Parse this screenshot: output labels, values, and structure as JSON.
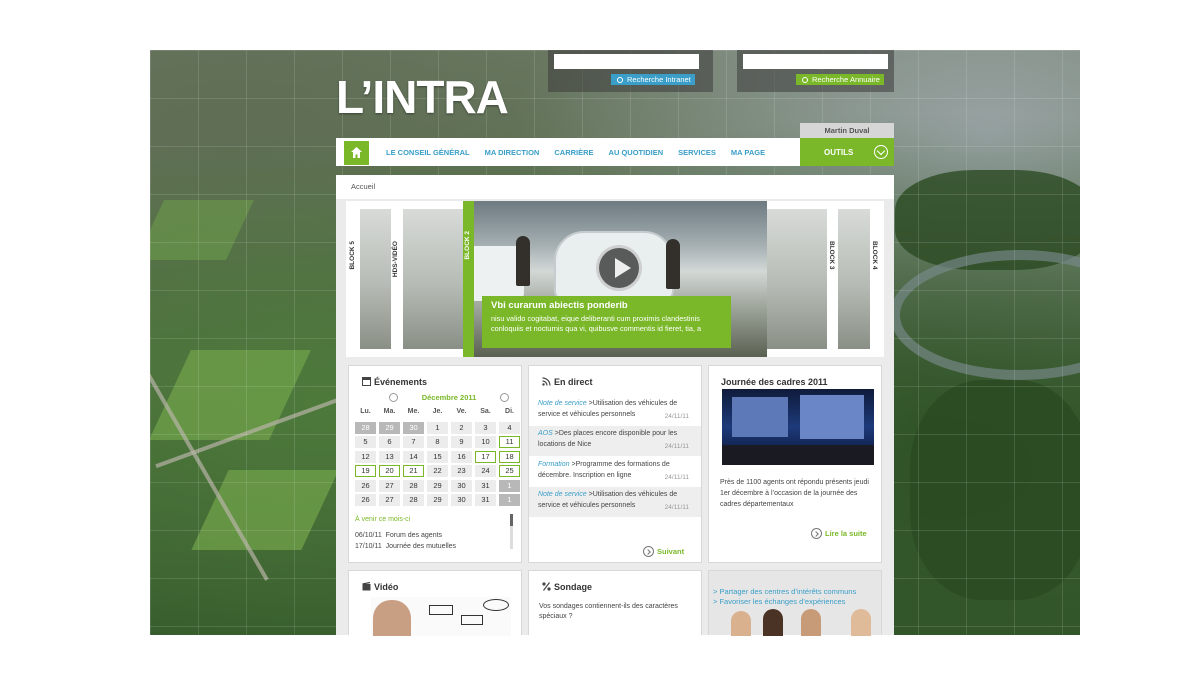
{
  "site": {
    "logo": "L’INTRA",
    "user_name": "Martin Duval"
  },
  "search": {
    "intranet_label": "Recherche Intranet",
    "directory_label": "Recherche Annuaire"
  },
  "nav": {
    "items": [
      "LE CONSEIL GÉNÉRAL",
      "MA DIRECTION",
      "CARRIÈRE",
      "AU QUOTIDIEN",
      "SERVICES",
      "MA PAGE"
    ],
    "tools_label": "OUTILS"
  },
  "breadcrumb": "Accueil",
  "carousel": {
    "tabs": [
      "BLOCK 5",
      "HDS-VIDÉO",
      "BLOCK 2",
      "BLOCK 3",
      "BLOCK 4"
    ],
    "caption_title": "Vbi curarum abiectis ponderib",
    "caption_text": "nisu valido cogitabat, eique deliberanti cum proximis clandestinis conloquiis et nocturnis qua vi, quibusve commentis id fieret, tia, a"
  },
  "events": {
    "title": "Événements",
    "month": "Décembre 2011",
    "weekdays": [
      "Lu.",
      "Ma.",
      "Me.",
      "Je.",
      "Ve.",
      "Sa.",
      "Di."
    ],
    "rows": [
      [
        "28",
        "29",
        "30",
        "1",
        "2",
        "3",
        "4"
      ],
      [
        "6",
        "7",
        "8",
        "9",
        "10",
        "11"
      ],
      [
        "13",
        "14",
        "15",
        "16",
        "17",
        "18"
      ],
      [
        "20",
        "21",
        "22",
        "23",
        "24",
        "25"
      ],
      [
        "26",
        "27",
        "28",
        "29",
        "30",
        "31",
        "1"
      ],
      [
        "26",
        "27",
        "28",
        "29",
        "30",
        "31",
        "1"
      ]
    ],
    "row_first": [
      "5",
      "12",
      "19"
    ],
    "upcoming_title": "À venir ce mois-ci",
    "upcoming": [
      {
        "date": "06/10/11",
        "label": "Forum des agents"
      },
      {
        "date": "17/10/11",
        "label": "Journée des mutuelles"
      }
    ]
  },
  "live": {
    "title": "En direct",
    "items": [
      {
        "cat": "Note de service",
        "text": "Utilisation des véhicules de service et véhicules personnels",
        "date": "24/11/11"
      },
      {
        "cat": "AOS",
        "text": "Des places encore disponible pour les locations de Nice",
        "date": "24/11/11"
      },
      {
        "cat": "Formation",
        "text": "Programme des formations de décembre. Inscription en ligne",
        "date": "24/11/11"
      },
      {
        "cat": "Note de service",
        "text": "Utilisation des véhicules de service et véhicules personnels",
        "date": "24/11/11"
      }
    ],
    "more": "Suivant"
  },
  "cadres": {
    "title": "Journée des cadres 2011",
    "text": "Près de 1100 agents ont répondu présents jeudi 1er décembre à l’occasion de la journée des cadres départementaux",
    "more": "Lire la suite"
  },
  "video": {
    "title": "Vidéo"
  },
  "poll": {
    "title": "Sondage",
    "question": "Vos sondages contiennent-ils des caractères spéciaux ?"
  },
  "share": {
    "line1": "> Partager des centres d’intérêts communs",
    "line2": "> Favoriser les échanges d’expériences"
  },
  "colors": {
    "accent_green": "#7ab829",
    "link_blue": "#3a9ec8"
  }
}
